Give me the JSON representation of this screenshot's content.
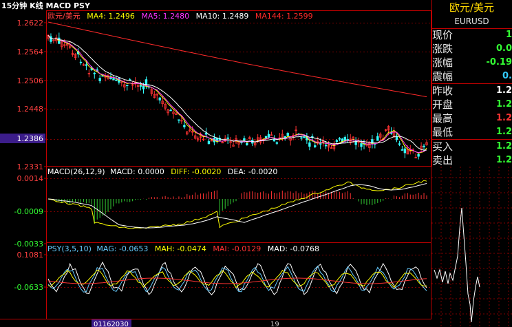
{
  "header": {
    "title": "15分钟 K线 MACD PSY"
  },
  "kline": {
    "legend_name": "欧元/美元",
    "ma": [
      {
        "label": "MA4: 1.2496",
        "color": "#ffff00"
      },
      {
        "label": "MA5: 1.2480",
        "color": "#ff33ff"
      },
      {
        "label": "MA10: 1.2489",
        "color": "#ffffff"
      },
      {
        "label": "MA144: 1.2599",
        "color": "#ff2a2a"
      }
    ],
    "y_ticks": [
      "1.2622",
      "1.2564",
      "1.2506",
      "1.2448",
      "1.2386",
      "1.2331"
    ],
    "y_tick_values": [
      1.2622,
      1.2564,
      1.2506,
      1.2448,
      1.2386,
      1.2331
    ],
    "current_price_tag": "1.2386"
  },
  "macd": {
    "legend": [
      {
        "label": "MACD(26,12,9)",
        "color": "#ffffff"
      },
      {
        "label": "MACD: 0.0000",
        "color": "#ffffff"
      },
      {
        "label": "DIFF: -0.0020",
        "color": "#ffff00"
      },
      {
        "label": "DEA: -0.0020",
        "color": "#ffffff"
      }
    ],
    "y_ticks": [
      "0.0014",
      "-0.0009",
      "-0.0033"
    ],
    "y_tick_values": [
      0.0014,
      -0.0009,
      -0.0033
    ]
  },
  "psy": {
    "legend": [
      {
        "label": "PSY(3,5,10)",
        "color": "#66ccff"
      },
      {
        "label": "MAG: -0.0653",
        "color": "#66ccff"
      },
      {
        "label": "MAH: -0.0474",
        "color": "#ffff00"
      },
      {
        "label": "MAI: -0.0129",
        "color": "#ff3333"
      },
      {
        "label": "MAD: -0.0768",
        "color": "#ffffff"
      }
    ],
    "y_ticks": [
      "0.1081",
      "-0.0633"
    ],
    "y_tick_values": [
      0.1081,
      -0.0633
    ]
  },
  "time_axis": {
    "labels": [
      "01162030",
      "19"
    ]
  },
  "quote": {
    "name": "欧元/美元",
    "code": "EURUSD",
    "rows": [
      {
        "label": "现价",
        "value": "1",
        "color": "#33ff33"
      },
      {
        "label": "涨跌",
        "value": "0.0",
        "color": "#33ff33"
      },
      {
        "label": "涨幅",
        "value": "-0.19",
        "color": "#33ff33"
      },
      {
        "label": "震幅",
        "value": "0.",
        "color": "#33ccff"
      },
      {
        "label": "昨收",
        "value": "1.2",
        "color": "#ffffff"
      },
      {
        "label": "开盘",
        "value": "1.2",
        "color": "#33ff33"
      },
      {
        "label": "最高",
        "value": "1.2",
        "color": "#ff3333"
      },
      {
        "label": "最低",
        "value": "1.2",
        "color": "#33ff33"
      },
      {
        "label": "买入",
        "value": "1.2",
        "color": "#33ff33"
      },
      {
        "label": "卖出",
        "value": "1.2",
        "color": "#33ff33"
      }
    ]
  },
  "colors": {
    "up": "#ff3333",
    "down": "#33ffff",
    "frame": "#c00000",
    "grid": "#800000",
    "macd_down": "#33cc33"
  }
}
